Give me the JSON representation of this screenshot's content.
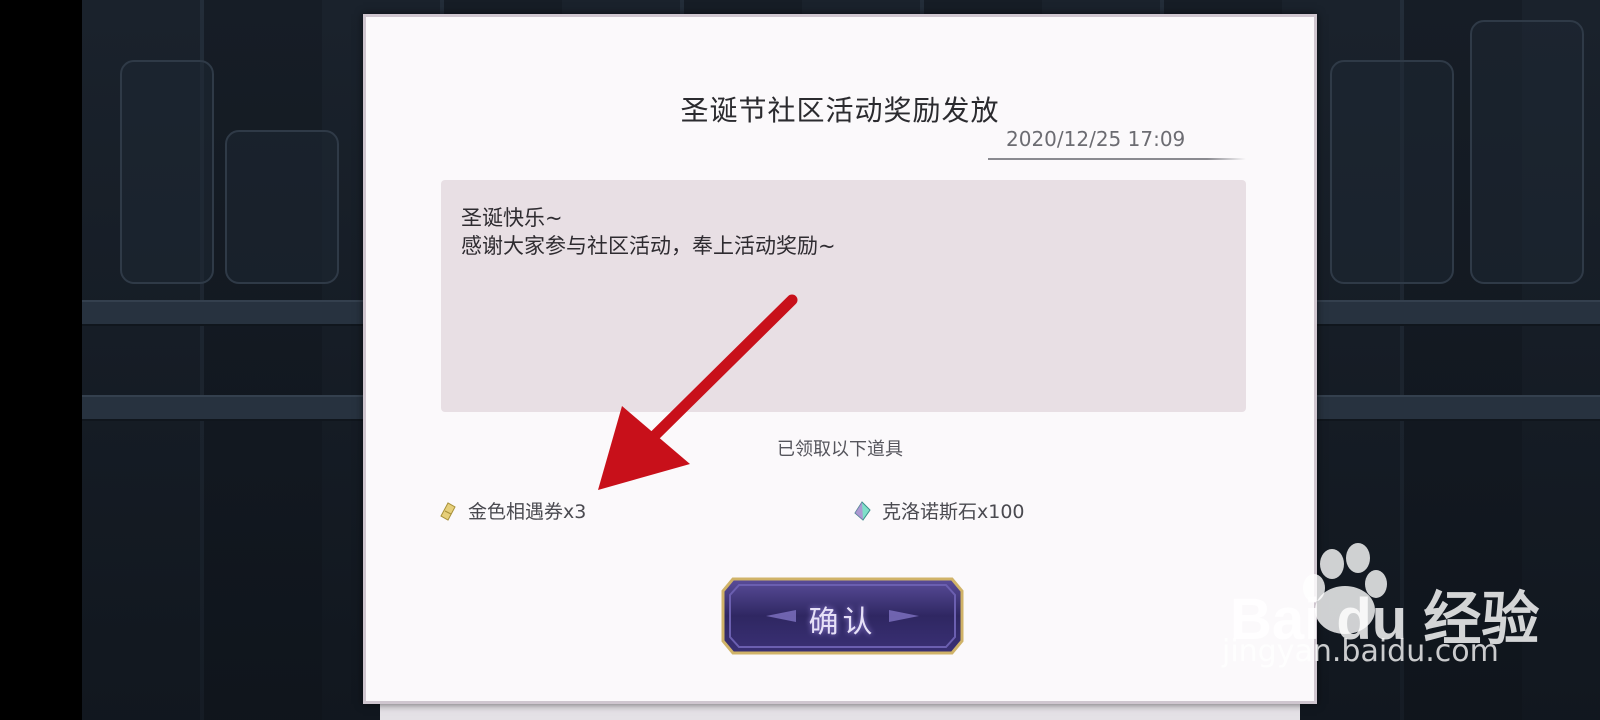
{
  "dialog": {
    "title": "圣诞节社区活动奖励发放",
    "date": "2020/12/25 17:09",
    "message_lines": [
      "圣诞快乐~",
      "感谢大家参与社区活动，奉上活动奖励~"
    ],
    "received_label": "已领取以下道具",
    "rewards": [
      {
        "label": "金色相遇券x3",
        "icon": "ticket-icon",
        "color": "#e0c46a"
      },
      {
        "label": "克洛诺斯石x100",
        "icon": "crystal-icon",
        "color": "#6ad3c0"
      }
    ],
    "confirm_label": "确认"
  },
  "watermark": {
    "brand": "Bai  du 经验",
    "url": "jingyan.baidu.com"
  },
  "colors": {
    "arrow": "#c8101a",
    "button": "#3b3170",
    "button_border": "#c8a95a"
  }
}
